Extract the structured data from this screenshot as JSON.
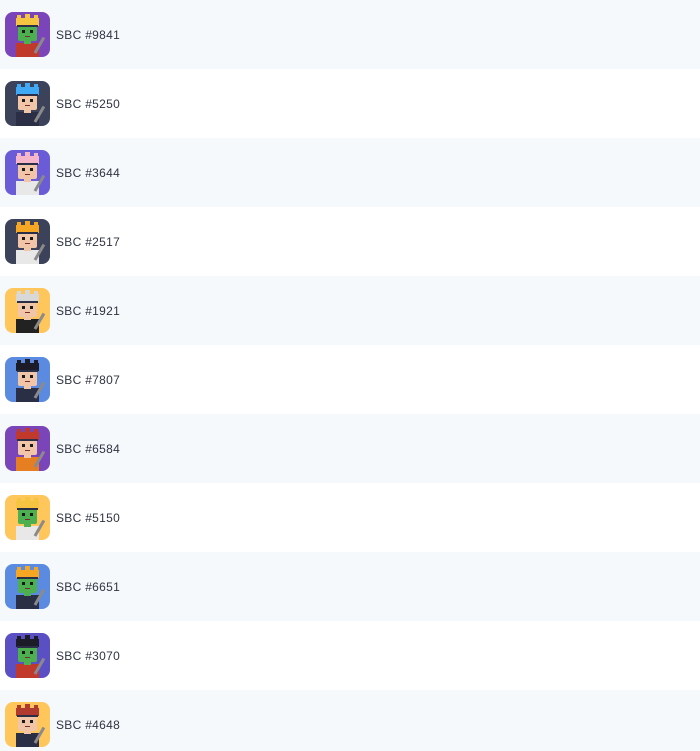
{
  "items": [
    {
      "label": "SBC #9841",
      "bg": "#7a45b8",
      "skin": "#4caf50",
      "hair": "#f5c542",
      "outfit": "#c0392b"
    },
    {
      "label": "SBC #5250",
      "bg": "#3b4259",
      "skin": "#f1c6a8",
      "hair": "#3fa9f5",
      "outfit": "#2b2f45"
    },
    {
      "label": "SBC #3644",
      "bg": "#6a5cd6",
      "skin": "#f1c6a8",
      "hair": "#f4b6c8",
      "outfit": "#e8e8e8"
    },
    {
      "label": "SBC #2517",
      "bg": "#3b4259",
      "skin": "#f1c6a8",
      "hair": "#f5a623",
      "outfit": "#e8e8e8"
    },
    {
      "label": "SBC #1921",
      "bg": "#ffc65c",
      "skin": "#f1c6a8",
      "hair": "#d8d8d8",
      "outfit": "#222222"
    },
    {
      "label": "SBC #7807",
      "bg": "#5a8be0",
      "skin": "#f1c6a8",
      "hair": "#1c1c28",
      "outfit": "#2b2f45"
    },
    {
      "label": "SBC #6584",
      "bg": "#7a45b8",
      "skin": "#f1c6a8",
      "hair": "#c0392b",
      "outfit": "#e67e22"
    },
    {
      "label": "SBC #5150",
      "bg": "#ffc65c",
      "skin": "#4caf50",
      "hair": "#f5c542",
      "outfit": "#e8e8e8"
    },
    {
      "label": "SBC #6651",
      "bg": "#5a8be0",
      "skin": "#4caf50",
      "hair": "#f5a623",
      "outfit": "#2b2f45"
    },
    {
      "label": "SBC #3070",
      "bg": "#5b4fc4",
      "skin": "#4caf50",
      "hair": "#1c1c28",
      "outfit": "#c0392b"
    },
    {
      "label": "SBC #4648",
      "bg": "#ffc65c",
      "skin": "#f1c6a8",
      "hair": "#b03a2e",
      "outfit": "#2b2f45"
    }
  ]
}
